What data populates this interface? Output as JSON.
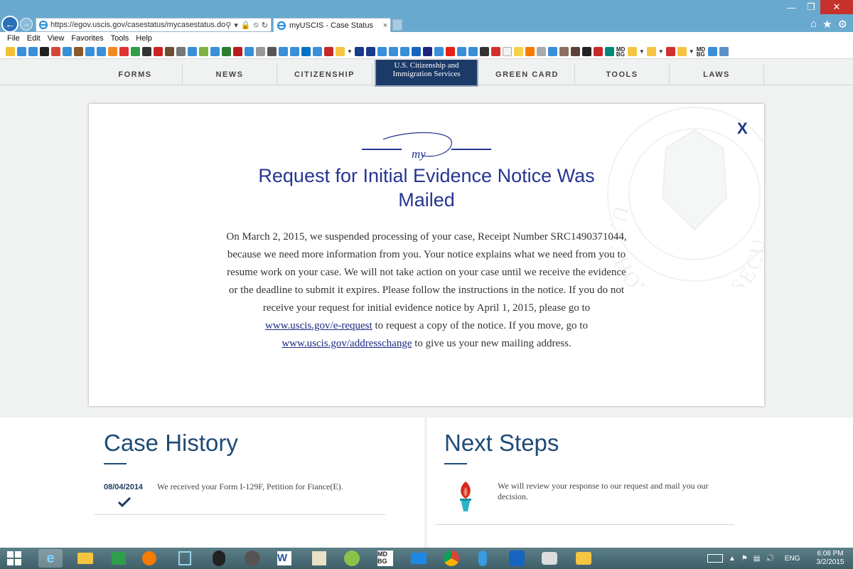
{
  "browser": {
    "url": "https://egov.uscis.gov/casestatus/mycasestatus.do?app",
    "tab_title": "myUSCIS - Case Status",
    "tab_close": "×",
    "menu": [
      "File",
      "Edit",
      "View",
      "Favorites",
      "Tools",
      "Help"
    ],
    "favbar_text": [
      "MD BG",
      "MD BG"
    ]
  },
  "nav": {
    "items": [
      "FORMS",
      "NEWS",
      "CITIZENSHIP",
      "GREEN CARD",
      "TOOLS",
      "LAWS"
    ],
    "logo_lines": [
      "U.S. Citizenship and",
      "Immigration Services"
    ]
  },
  "modal": {
    "close": "X",
    "logo_text": "my",
    "title": "Request for Initial Evidence Notice Was Mailed",
    "body_part1": "On March 2, 2015, we suspended processing of your case, Receipt Number SRC1490371044, because we need more information from you. Your notice explains what we need from you to resume work on your case. We will not take action on your case until we receive the evidence or the deadline to submit it expires. Please follow the instructions in the notice. If you do not receive your request for initial evidence notice by April 1, 2015, please go to ",
    "link1": "www.uscis.gov/e-request",
    "body_part2": " to request a copy of the notice. If you move, go to ",
    "link2": "www.uscis.gov/addresschange",
    "body_part3": " to give us your new mailing address.",
    "seal_text": "U.S. HOMELAND SECU"
  },
  "case_history": {
    "title": "Case History",
    "items": [
      {
        "date": "08/04/2014",
        "text": "We received your Form I-129F, Petition for Fiance(E)."
      }
    ]
  },
  "next_steps": {
    "title": "Next Steps",
    "text": "We will review your response to our request and mail you our decision."
  },
  "taskbar": {
    "language": "ENG",
    "time": "6:08 PM",
    "date": "3/2/2015",
    "icon_labels": {
      "word": "W",
      "mdbg": "MD BG"
    }
  },
  "colors": {
    "title_blue": "#263591",
    "panel_blue": "#1e4b76",
    "chrome_blue": "#6aa9cf",
    "close_red": "#c7312b"
  }
}
